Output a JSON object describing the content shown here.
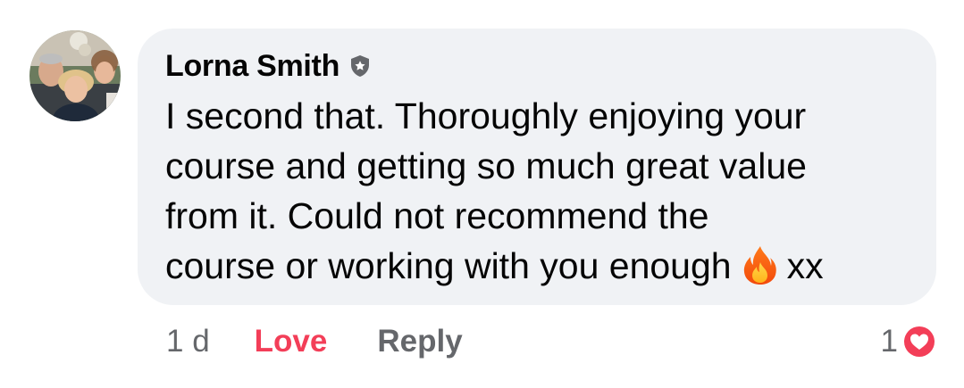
{
  "comment": {
    "author": "Lorna Smith",
    "lines": [
      "I second that. Thoroughly enjoying your",
      "course and getting so much great value",
      "from it. Could not recommend the",
      "course or working with you enough"
    ],
    "trailing_text": "xx",
    "emoji": "fire-icon",
    "badge_icon": "shield-badge-icon"
  },
  "actions": {
    "time": "1 d",
    "love_label": "Love",
    "reply_label": "Reply"
  },
  "reactions": {
    "count": "1",
    "icon": "heart-icon",
    "color": "#f33e58"
  }
}
